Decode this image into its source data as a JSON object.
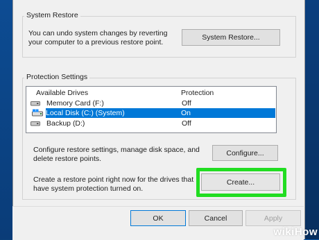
{
  "system_restore": {
    "group_title": "System Restore",
    "description_line1": "You can undo system changes by reverting",
    "description_line2": "your computer to a previous restore point.",
    "button_label": "System Restore..."
  },
  "protection": {
    "group_title": "Protection Settings",
    "columns": {
      "drives": "Available Drives",
      "protection": "Protection"
    },
    "drives": [
      {
        "name": "Memory Card (F:)",
        "protection": "Off",
        "icon": "removable-drive-icon",
        "selected": false
      },
      {
        "name": "Local Disk (C:) (System)",
        "protection": "On",
        "icon": "system-drive-icon",
        "selected": true
      },
      {
        "name": "Backup (D:)",
        "protection": "Off",
        "icon": "hard-drive-icon",
        "selected": false
      }
    ],
    "configure_text_line1": "Configure restore settings, manage disk space, and",
    "configure_text_line2": "delete restore points.",
    "configure_label": "Configure...",
    "create_text_line1": "Create a restore point right now for the drives that",
    "create_text_line2": "have system protection turned on.",
    "create_label": "Create...",
    "highlight_color": "#22dd22"
  },
  "dialog_buttons": {
    "ok": "OK",
    "cancel": "Cancel",
    "apply": "Apply"
  },
  "watermark": "wikiHow",
  "colors": {
    "selection": "#0078d7",
    "desktop": "#0e5aa8",
    "dialog": "#f0f0f0"
  }
}
